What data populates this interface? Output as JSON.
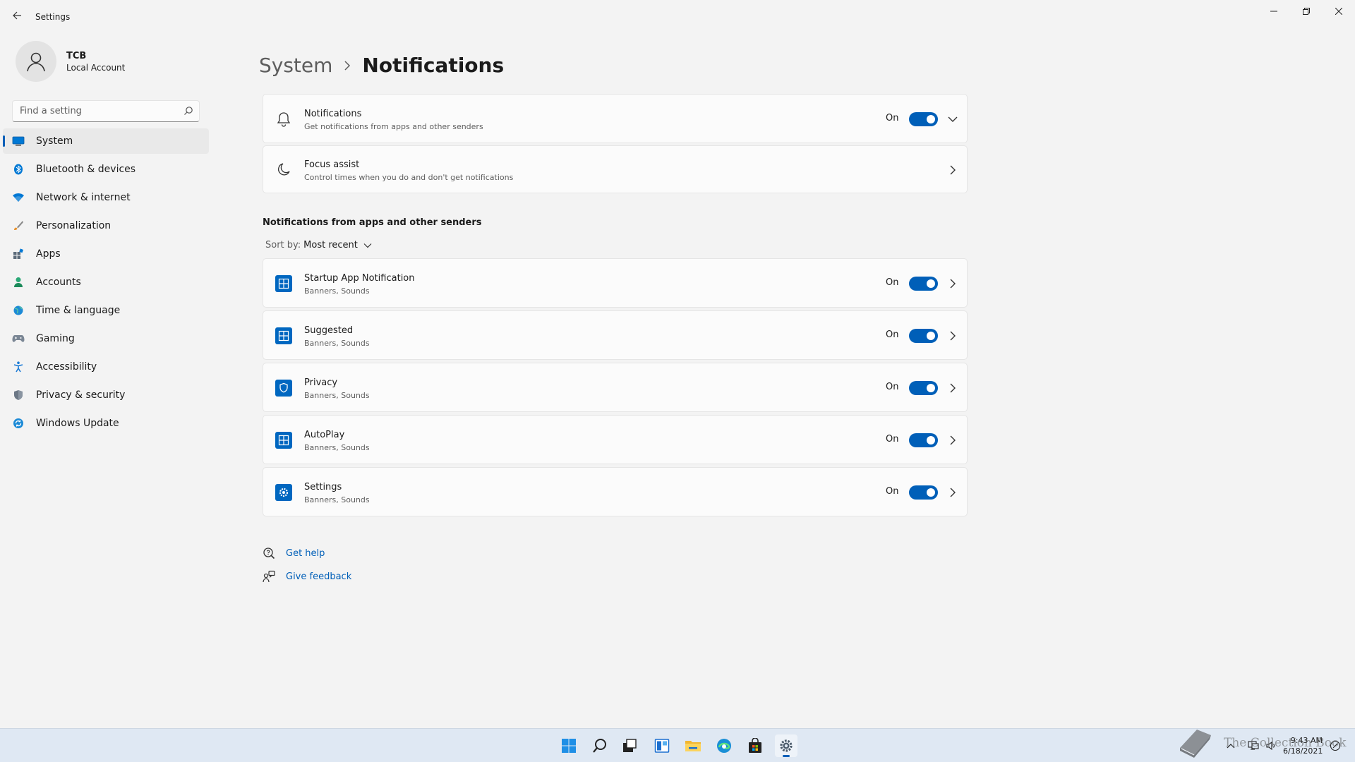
{
  "window": {
    "title": "Settings"
  },
  "profile": {
    "name": "TCB",
    "account_type": "Local Account"
  },
  "search": {
    "placeholder": "Find a setting"
  },
  "sidebar": {
    "items": [
      {
        "label": "System",
        "icon": "monitor-icon",
        "active": true
      },
      {
        "label": "Bluetooth & devices",
        "icon": "bluetooth-icon"
      },
      {
        "label": "Network & internet",
        "icon": "wifi-icon"
      },
      {
        "label": "Personalization",
        "icon": "brush-icon"
      },
      {
        "label": "Apps",
        "icon": "apps-icon"
      },
      {
        "label": "Accounts",
        "icon": "person-icon"
      },
      {
        "label": "Time & language",
        "icon": "globe-clock-icon"
      },
      {
        "label": "Gaming",
        "icon": "gamepad-icon"
      },
      {
        "label": "Accessibility",
        "icon": "accessibility-icon"
      },
      {
        "label": "Privacy & security",
        "icon": "shield-icon"
      },
      {
        "label": "Windows Update",
        "icon": "update-icon"
      }
    ]
  },
  "breadcrumb": {
    "parent": "System",
    "current": "Notifications"
  },
  "main": {
    "notifications": {
      "title": "Notifications",
      "subtitle": "Get notifications from apps and other senders",
      "state": "On"
    },
    "focus_assist": {
      "title": "Focus assist",
      "subtitle": "Control times when you do and don't get notifications"
    },
    "section_title": "Notifications from apps and other senders",
    "sort": {
      "label": "Sort by:",
      "value": "Most recent"
    },
    "senders": [
      {
        "name": "Startup App Notification",
        "detail": "Banners, Sounds",
        "state": "On",
        "icon": "app-tile-icon"
      },
      {
        "name": "Suggested",
        "detail": "Banners, Sounds",
        "state": "On",
        "icon": "app-tile-icon"
      },
      {
        "name": "Privacy",
        "detail": "Banners, Sounds",
        "state": "On",
        "icon": "privacy-shield-icon"
      },
      {
        "name": "AutoPlay",
        "detail": "Banners, Sounds",
        "state": "On",
        "icon": "app-tile-icon"
      },
      {
        "name": "Settings",
        "detail": "Banners, Sounds",
        "state": "On",
        "icon": "settings-gear-icon"
      }
    ],
    "links": {
      "help": "Get help",
      "feedback": "Give feedback"
    }
  },
  "taskbar": {
    "time": "9:43 AM",
    "date": "6/18/2021"
  },
  "watermark": {
    "text": "The Collection Book"
  },
  "colors": {
    "accent": "#005fb8",
    "background": "#f3f3f3",
    "card": "#fbfbfb",
    "taskbar": "#dfe8f3"
  }
}
